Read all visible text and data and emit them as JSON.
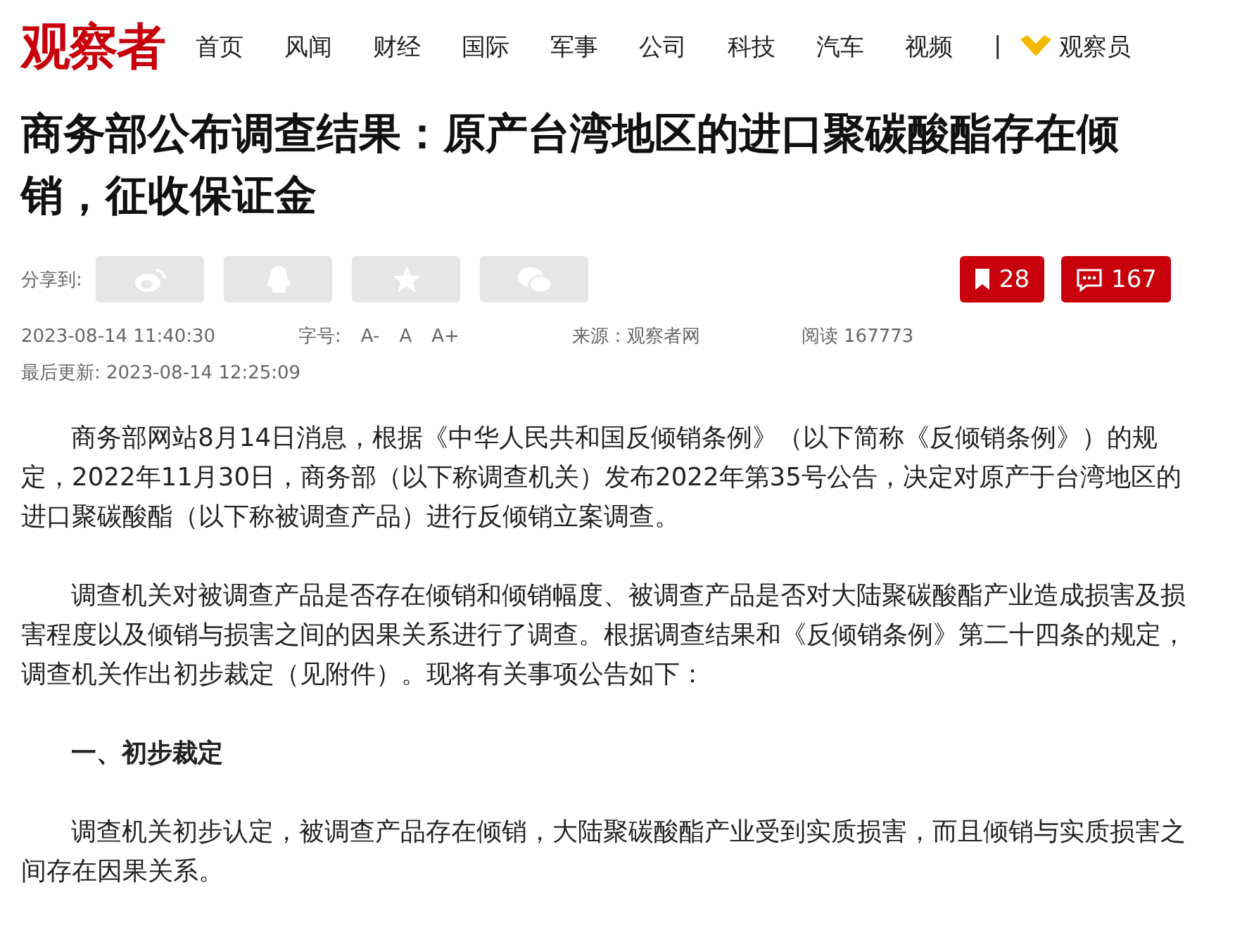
{
  "header": {
    "logo": "观察者",
    "nav": [
      "首页",
      "风闻",
      "财经",
      "国际",
      "军事",
      "公司",
      "科技",
      "汽车",
      "视频"
    ],
    "separator": "|",
    "member": "观察员"
  },
  "title": "商务部公布调查结果：原产台湾地区的进口聚碳酸酯存在倾销，征收保证金",
  "share": {
    "label": "分享到:",
    "buttons": [
      {
        "kind": "weibo"
      },
      {
        "kind": "qq"
      },
      {
        "kind": "qzone"
      },
      {
        "kind": "wechat"
      }
    ]
  },
  "counters": [
    {
      "kind": "bookmark",
      "value": "28"
    },
    {
      "kind": "comment",
      "value": "167"
    }
  ],
  "meta": {
    "published": "2023-08-14 11:40:30",
    "font_label": "字号:",
    "font_sizes": [
      "A-",
      "A",
      "A+"
    ],
    "source": "来源：观察者网",
    "reads": "阅读 167773",
    "updated": "最后更新: 2023-08-14 12:25:09"
  },
  "paragraphs": [
    {
      "kind": "text",
      "text": "商务部网站8月14日消息，根据《中华人民共和国反倾销条例》（以下简称《反倾销条例》）的规定，2022年11月30日，商务部（以下称调查机关）发布2022年第35号公告，决定对原产于台湾地区的进口聚碳酸酯（以下称被调查产品）进行反倾销立案调查。"
    },
    {
      "kind": "text",
      "text": "调查机关对被调查产品是否存在倾销和倾销幅度、被调查产品是否对大陆聚碳酸酯产业造成损害及损害程度以及倾销与损害之间的因果关系进行了调查。根据调查结果和《反倾销条例》第二十四条的规定，调查机关作出初步裁定（见附件）。现将有关事项公告如下："
    },
    {
      "kind": "heading",
      "text": "一、初步裁定"
    },
    {
      "kind": "text",
      "text": "调查机关初步认定，被调查产品存在倾销，大陆聚碳酸酯产业受到实质损害，而且倾销与实质损害之间存在因果关系。"
    }
  ]
}
